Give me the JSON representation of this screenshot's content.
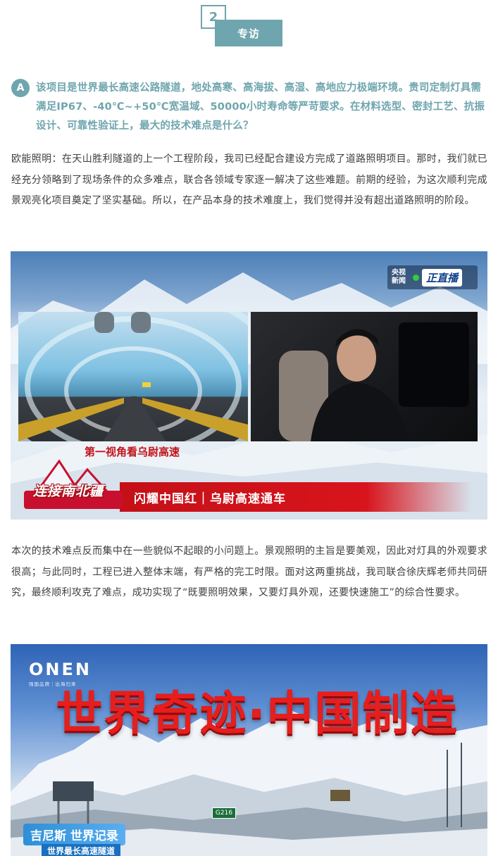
{
  "badge": {
    "number": "2",
    "label": "专访"
  },
  "question": {
    "marker": "A",
    "text": "该项目是世界最长高速公路隧道，地处高寒、高海拔、高湿、高地应力极端环境。贵司定制灯具需满足IP67、-40℃~+50℃宽温域、50000小时寿命等严苛要求。在材料选型、密封工艺、抗振设计、可靠性验证上，最大的技术难点是什么？"
  },
  "answer1": "欧能照明：在天山胜利隧道的上一个工程阶段，我司已经配合建设方完成了道路照明项目。那时，我们就已经充分领略到了现场条件的众多难点，联合各领域专家逐一解决了这些难题。前期的经验，为这次顺利完成景观亮化项目奠定了坚实基础。所以，在产品本身的技术难度上，我们觉得并没有超出道路照明的阶段。",
  "figure1": {
    "channel_logo": "央视新闻",
    "live_label": "正直播",
    "subtitle": "第一视角看乌尉高速",
    "brand_badge": "连接南北疆",
    "banner": "闪耀中国红｜乌尉高速通车"
  },
  "answer2": "本次的技术难点反而集中在一些貌似不起眼的小问题上。景观照明的主旨是要美观，因此对灯具的外观要求很高；与此同时，工程已进入整体末端，有严格的完工时限。面对这两重挑战，我司联合徐庆辉老师共同研究，最终顺利攻克了难点，成功实现了“既要照明效果，又要灯具外观，还要快速施工”的综合性要求。",
  "figure2": {
    "logo": "ONEN",
    "logo_tagline": "强国品牌｜出海归来",
    "title": "世界奇迹·中国制造",
    "record": "吉尼斯 世界记录",
    "record_sub": "世界最长高速隧道",
    "road_sign": "G216"
  }
}
